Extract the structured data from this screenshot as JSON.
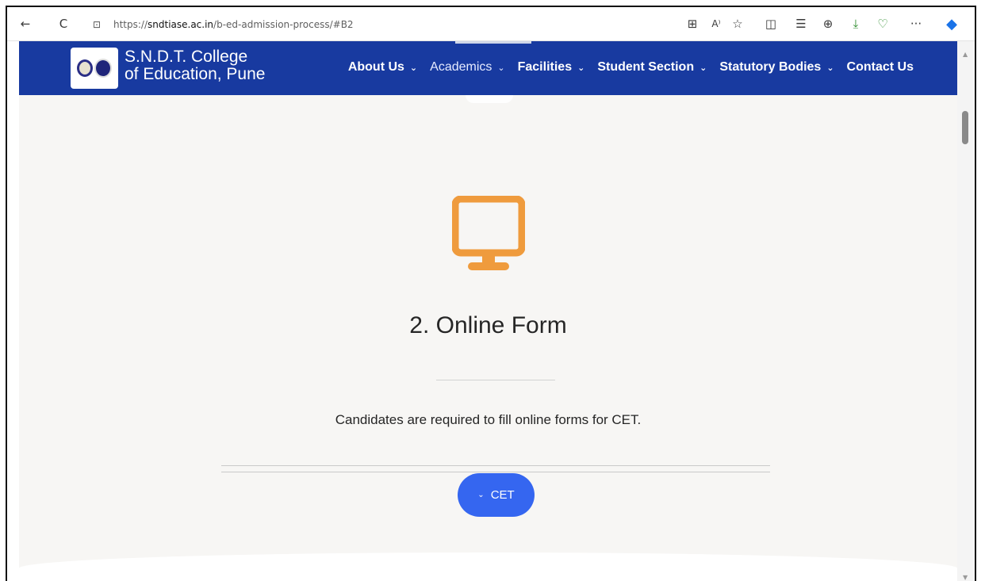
{
  "browser": {
    "back_glyph": "←",
    "refresh_glyph": "C",
    "lock_glyph": "⊡",
    "url_prefix": "https://",
    "url_host": "sndtiase.ac.in",
    "url_path": "/b-ed-admission-process/#B2",
    "toolbar_icons": [
      {
        "name": "app-available-icon",
        "glyph": "⊞"
      },
      {
        "name": "read-aloud-icon",
        "glyph": "A⁾"
      },
      {
        "name": "favorite-star-icon",
        "glyph": "☆"
      },
      {
        "name": "split-screen-icon",
        "glyph": "◫"
      },
      {
        "name": "favorites-list-icon",
        "glyph": "☰"
      },
      {
        "name": "collections-icon",
        "glyph": "⊕"
      },
      {
        "name": "downloads-icon",
        "glyph": "⤓"
      },
      {
        "name": "health-icon",
        "glyph": "♡"
      },
      {
        "name": "more-icon",
        "glyph": "···"
      },
      {
        "name": "copilot-icon",
        "glyph": "◆"
      }
    ]
  },
  "site": {
    "brand_line1": "S.N.D.T. College",
    "brand_line2": "of Education, Pune",
    "nav": [
      {
        "label": "About Us",
        "chevron": "⌄"
      },
      {
        "label": "Academics",
        "chevron": "⌄"
      },
      {
        "label": "Facilities",
        "chevron": "⌄"
      },
      {
        "label": "Student Section",
        "chevron": "⌄"
      },
      {
        "label": "Statutory Bodies",
        "chevron": "⌄"
      },
      {
        "label": "Contact Us"
      }
    ]
  },
  "content": {
    "step_icon": "monitor-icon",
    "heading": "2. Online Form",
    "description": "Candidates are required to fill online forms for CET.",
    "accordion_button": "CET",
    "accordion_chevron": "⌄"
  },
  "colors": {
    "header_bg": "#183aa0",
    "icon_orange": "#ef9b3d",
    "button_blue": "#3566f0",
    "page_bg": "#f7f6f4"
  }
}
